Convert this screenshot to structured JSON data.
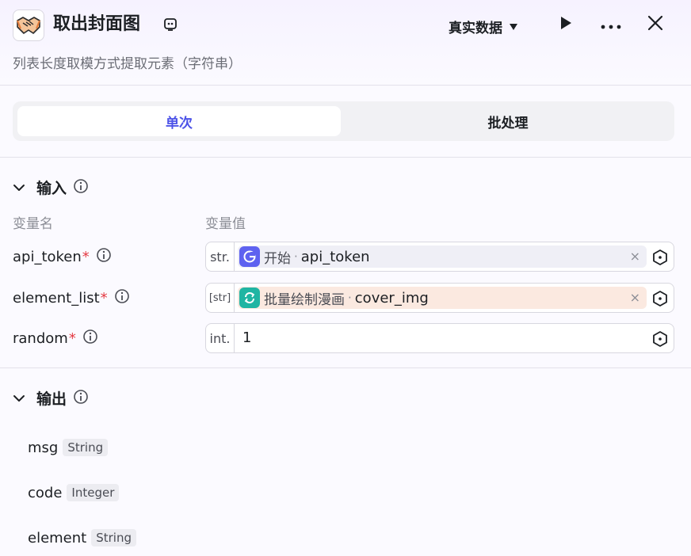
{
  "header": {
    "title": "取出封面图",
    "subtitle": "列表长度取模方式提取元素（字符串）",
    "mode_label": "真实数据"
  },
  "tabs": [
    {
      "label": "单次",
      "active": true
    },
    {
      "label": "批处理",
      "active": false
    }
  ],
  "input": {
    "section_label": "输入",
    "col_name": "变量名",
    "col_value": "变量值",
    "params": [
      {
        "name": "api_token",
        "required": "*",
        "type": "str.",
        "ref_node": "开始",
        "ref_sep": "·",
        "ref_var": "api_token",
        "clear": "×"
      },
      {
        "name": "element_list",
        "required": "*",
        "type": "[str]",
        "ref_node": "批量绘制漫画",
        "ref_sep": "·",
        "ref_var": "cover_img",
        "clear": "×"
      },
      {
        "name": "random",
        "required": "*",
        "type": "int.",
        "value": "1"
      }
    ]
  },
  "output": {
    "section_label": "输出",
    "fields": [
      {
        "name": "msg",
        "type": "String"
      },
      {
        "name": "code",
        "type": "Integer"
      },
      {
        "name": "element",
        "type": "String"
      }
    ]
  },
  "colors": {
    "accent": "#4d53e8",
    "required": "#e43a43",
    "start_node_icon": "#5e62f0",
    "loop_node_icon": "#1fb5a3"
  },
  "icons": {
    "node": "handshake-icon",
    "edit": "edit-title-icon",
    "dropdown": "caret-down-icon",
    "run": "play-icon",
    "more": "more-icon",
    "close": "close-icon",
    "info": "info-icon",
    "collapse": "chevron-down-icon",
    "variable_select": "hexagon-dot-icon"
  }
}
